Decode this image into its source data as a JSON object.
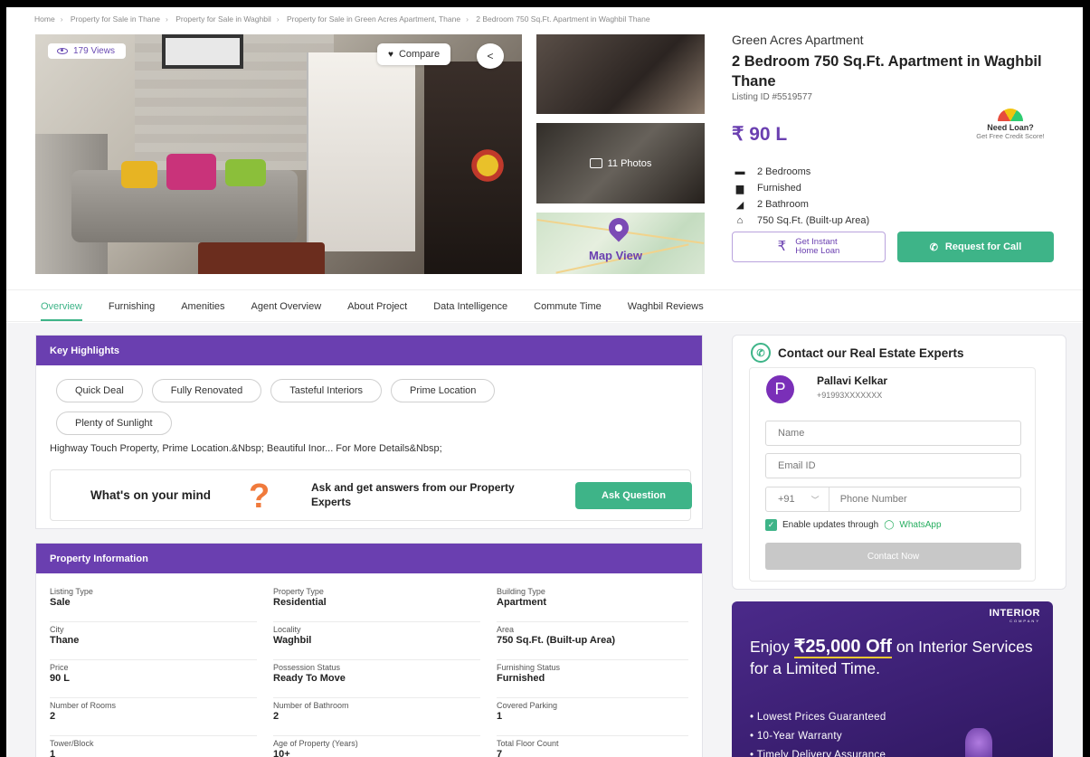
{
  "breadcrumb": [
    "Home",
    "Property for Sale in Thane",
    "Property for Sale in Waghbil",
    "Property for Sale in Green Acres Apartment, Thane",
    "2 Bedroom 750 Sq.Ft. Apartment in Waghbil Thane"
  ],
  "gallery": {
    "views": "179 Views",
    "compare_label": "Compare",
    "photos_label": "11 Photos",
    "map_label": "Map View"
  },
  "listing": {
    "project": "Green Acres Apartment",
    "title": "2 Bedroom 750 Sq.Ft. Apartment in Waghbil Thane",
    "listing_id": "Listing ID #5519577",
    "price": "₹ 90 L",
    "loan_title": "Need Loan?",
    "loan_sub": "Get Free Credit Score!",
    "specs": [
      {
        "icon": "bed-icon",
        "text": "2 Bedrooms"
      },
      {
        "icon": "sofa-icon",
        "text": "Furnished"
      },
      {
        "icon": "bath-icon",
        "text": "2 Bathroom"
      },
      {
        "icon": "home-icon",
        "text": "750 Sq.Ft. (Built-up Area)"
      }
    ],
    "home_loan_line1": "Get Instant",
    "home_loan_line2": "Home Loan",
    "request_call": "Request for Call"
  },
  "tabs": [
    "Overview",
    "Furnishing",
    "Amenities",
    "Agent Overview",
    "About Project",
    "Data Intelligence",
    "Commute Time",
    "Waghbil Reviews"
  ],
  "highlights": {
    "heading": "Key Highlights",
    "chips": [
      "Quick Deal",
      "Fully Renovated",
      "Tasteful Interiors",
      "Prime Location",
      "Plenty of Sunlight"
    ],
    "text": "Highway Touch Property, Prime Location.&Nbsp; Beautiful Inor... For More Details&Nbsp;",
    "ask_title": "What's on your mind",
    "ask_sub": "Ask and get answers from our Property Experts",
    "ask_button": "Ask Question"
  },
  "property_info": {
    "heading": "Property Information",
    "rows": [
      [
        {
          "label": "Listing Type",
          "value": "Sale"
        },
        {
          "label": "Property Type",
          "value": "Residential"
        },
        {
          "label": "Building Type",
          "value": "Apartment"
        }
      ],
      [
        {
          "label": "City",
          "value": "Thane"
        },
        {
          "label": "Locality",
          "value": "Waghbil"
        },
        {
          "label": "Area",
          "value": "750 Sq.Ft. (Built-up Area)"
        }
      ],
      [
        {
          "label": "Price",
          "value": "90 L"
        },
        {
          "label": "Possession Status",
          "value": "Ready To Move"
        },
        {
          "label": "Furnishing Status",
          "value": "Furnished"
        }
      ],
      [
        {
          "label": "Number of Rooms",
          "value": "2"
        },
        {
          "label": "Number of Bathroom",
          "value": "2"
        },
        {
          "label": "Covered Parking",
          "value": "1"
        }
      ],
      [
        {
          "label": "Tower/Block",
          "value": "1"
        },
        {
          "label": "Age of Property (Years)",
          "value": "10+"
        },
        {
          "label": "Total Floor Count",
          "value": "7"
        }
      ]
    ]
  },
  "contact": {
    "heading": "Contact our Real Estate Experts",
    "agent_initial": "P",
    "agent_name": "Pallavi Kelkar",
    "agent_phone": "+91993XXXXXXX",
    "name_placeholder": "Name",
    "email_placeholder": "Email ID",
    "country_code": "+91",
    "phone_placeholder": "Phone Number",
    "whatsapp_prefix": "Enable updates through",
    "whatsapp_label": "WhatsApp",
    "submit": "Contact Now"
  },
  "ad": {
    "logo": "INTERIOR",
    "logo_sub": "COMPANY",
    "line_pre": "Enjoy ",
    "line_big": "₹25,000 Off",
    "line_post": " on Interior Services for a Limited Time.",
    "bullets": [
      "Lowest Prices Guaranteed",
      "10-Year Warranty",
      "Timely Delivery Assurance"
    ]
  },
  "colors": {
    "brand": "#6a3fb0",
    "accent": "#3eb488"
  }
}
